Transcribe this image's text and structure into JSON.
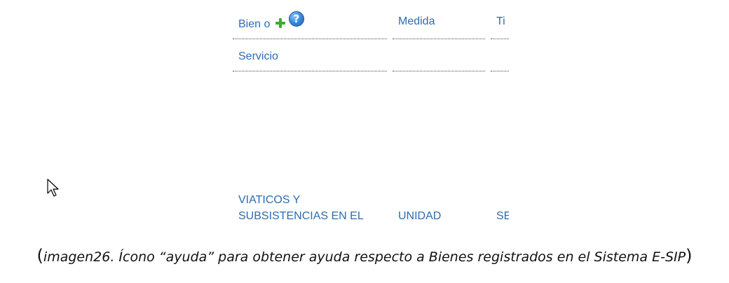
{
  "table": {
    "header": {
      "col1_line1": "Bien o",
      "col1_line2": "Servicio",
      "col2": "Medida",
      "col3": "Ti"
    },
    "row1": {
      "col1_line1": "VIATICOS Y",
      "col1_line2": "SUBSISTENCIAS EN EL",
      "col2": "UNIDAD",
      "col3": "SE"
    }
  },
  "icons": {
    "add": "plus-icon",
    "help": "help-icon",
    "help_glyph": "?",
    "cursor": "mouse-pointer-icon"
  },
  "caption": {
    "open_paren": "(",
    "text": "imagen26.  Ícono “ayuda” para obtener ayuda respecto a Bienes registrados en el Sistema E-SIP",
    "close_paren": ")"
  },
  "colors": {
    "link_blue": "#2a6db3",
    "plus_green": "#3aae2a",
    "help_blue": "#3d8fe0"
  }
}
